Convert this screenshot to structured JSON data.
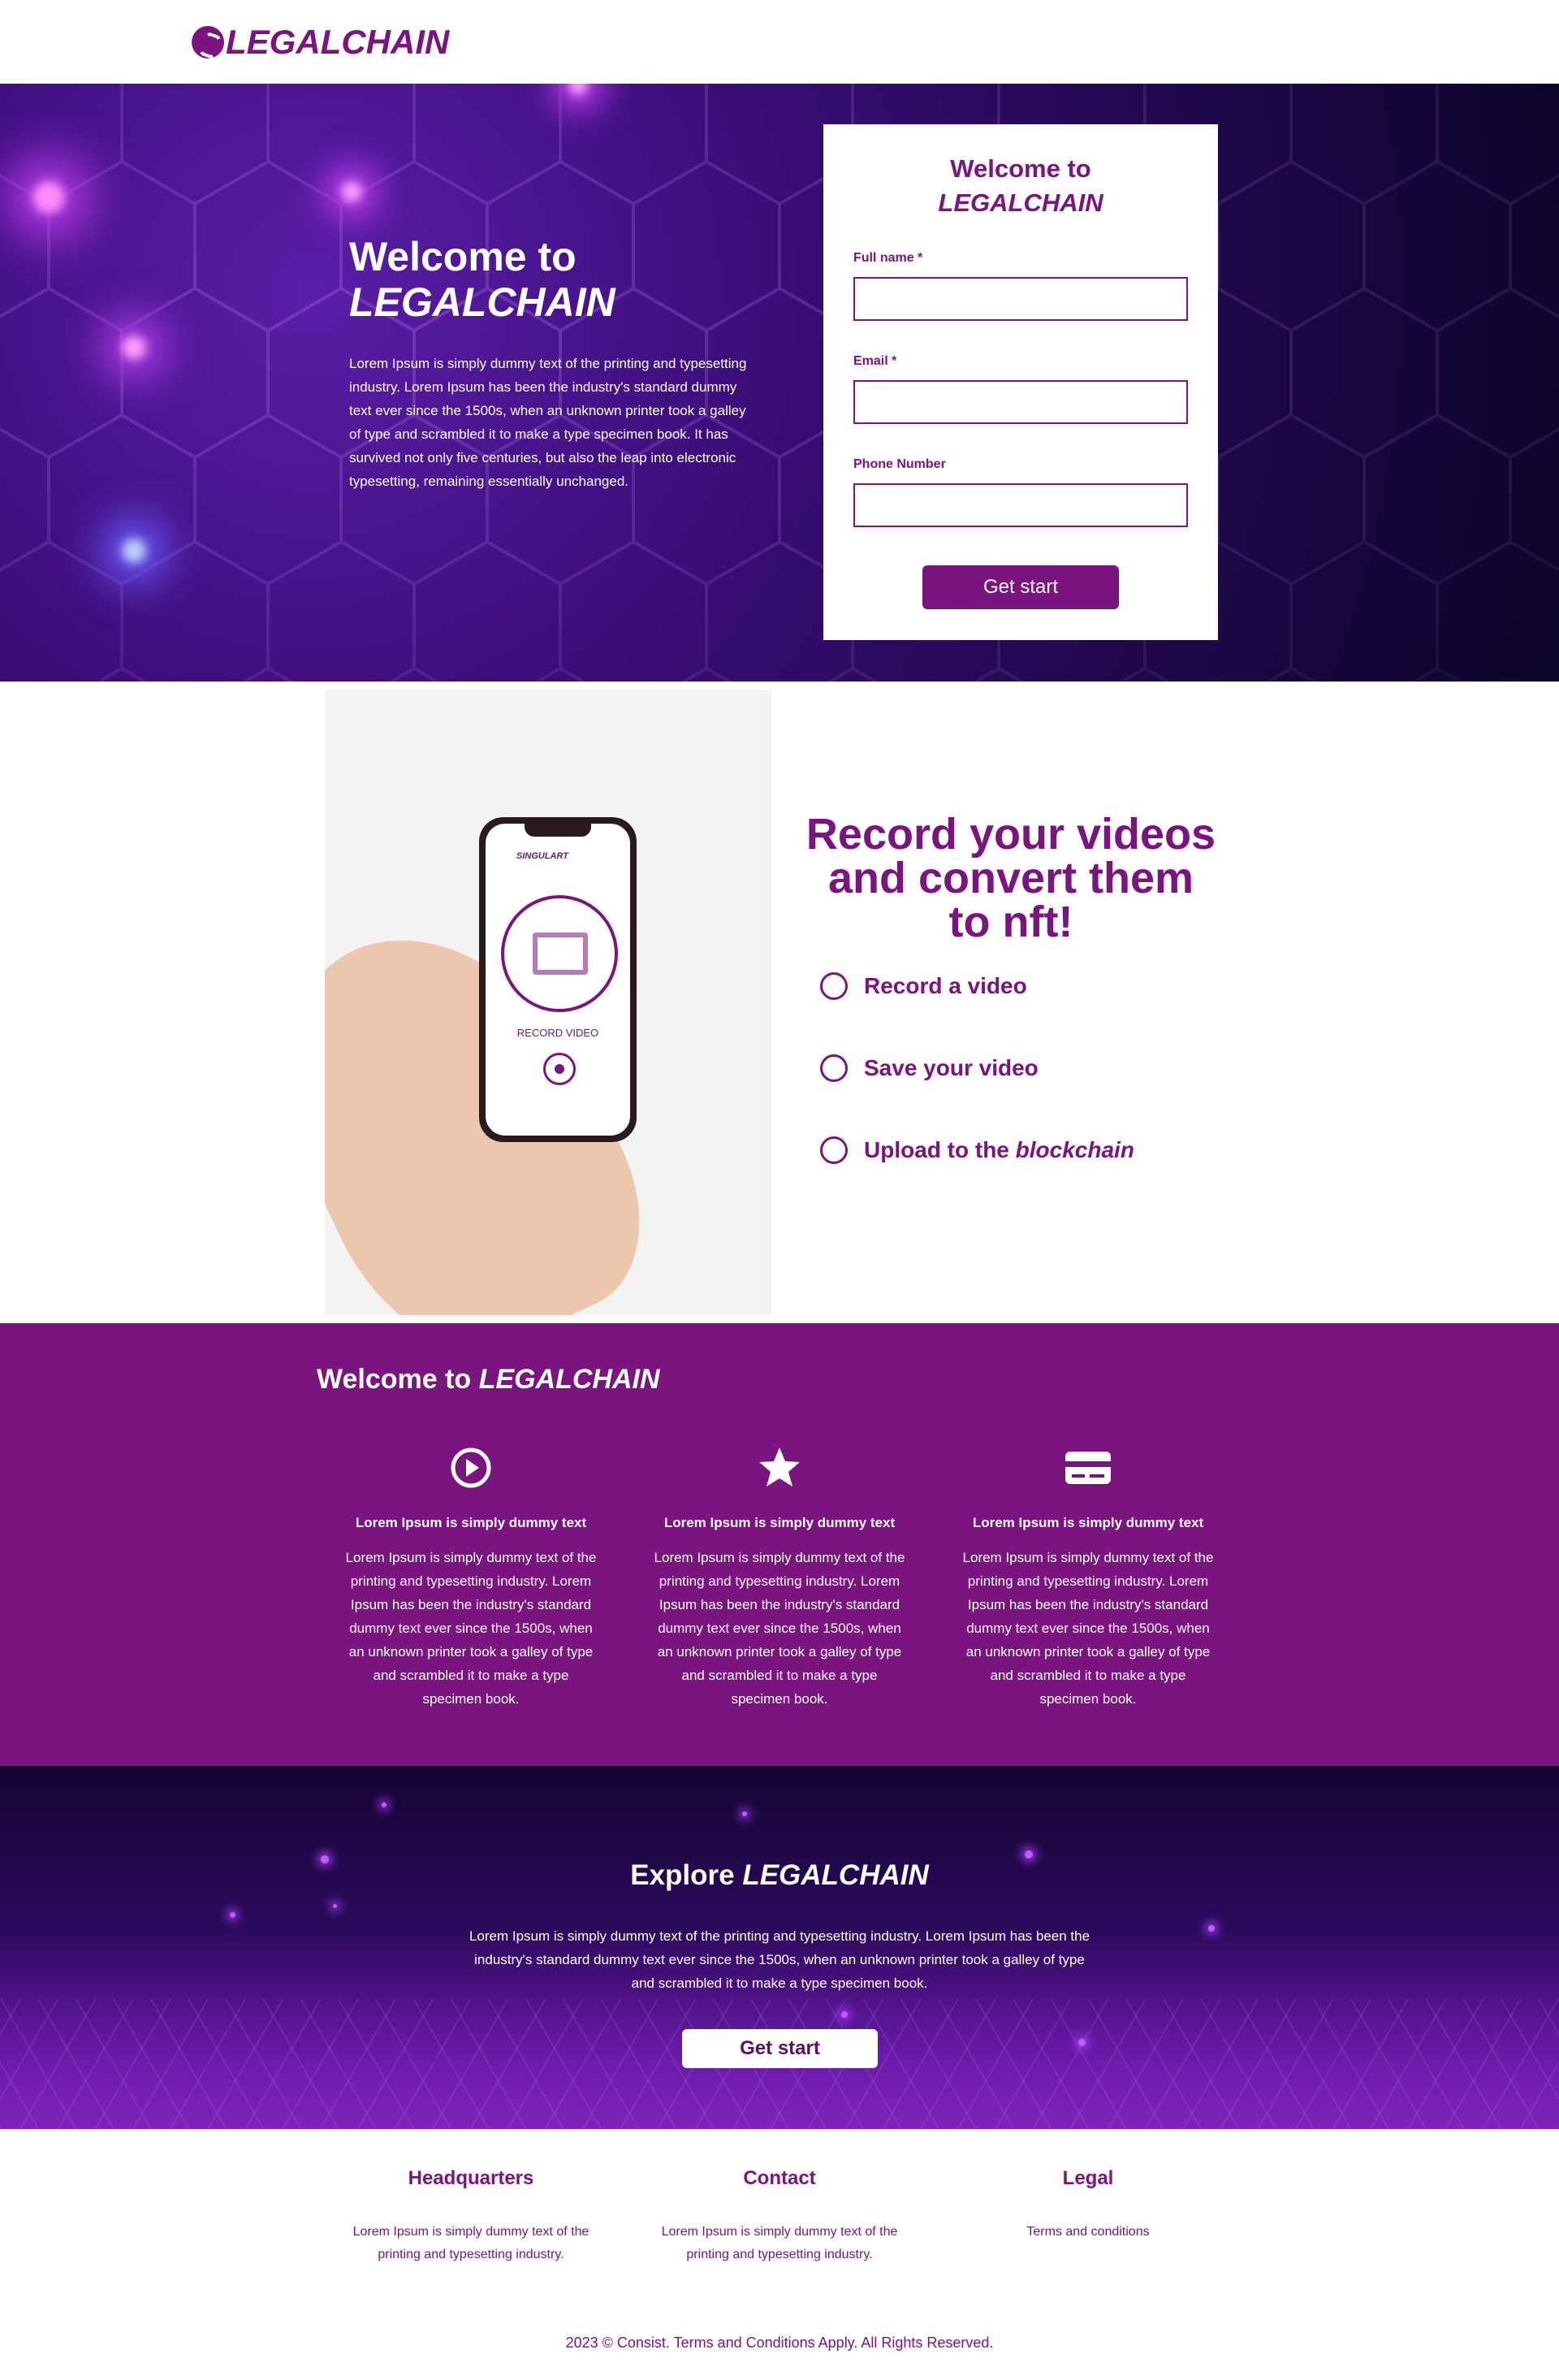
{
  "header": {
    "logo_text": "LEGALCHAIN"
  },
  "hero": {
    "title_line1": "Welcome to",
    "title_line2": "LEGALCHAIN",
    "body": "Lorem Ipsum is simply dummy text of the printing and typesetting industry. Lorem Ipsum has been the industry's standard dummy text ever since the 1500s, when an unknown printer took a galley of type and scrambled it to make a type specimen book. It has survived not only five centuries, but also the leap into electronic typesetting, remaining essentially unchanged."
  },
  "form": {
    "title_line1": "Welcome to",
    "title_line2": "LEGALCHAIN",
    "full_name_label": "Full name *",
    "full_name_value": "",
    "email_label": "Email *",
    "email_value": "",
    "phone_label": "Phone Number",
    "phone_value": "",
    "submit_label": "Get start"
  },
  "record": {
    "phone_brand": "SINGULART",
    "phone_record_label": "RECORD VIDEO",
    "title": "Record your videos and convert them to nft!",
    "steps": [
      {
        "label": "Record a video"
      },
      {
        "label": "Save your video"
      },
      {
        "label": "Upload to the ",
        "label_em": "blockchain"
      }
    ]
  },
  "features": {
    "title_prefix": "Welcome to ",
    "title_em": "LEGALCHAIN",
    "items": [
      {
        "icon": "play-circle-icon",
        "heading": "Lorem Ipsum is simply dummy text",
        "text": "Lorem Ipsum is simply dummy text of the printing and typesetting industry. Lorem Ipsum has been the industry's standard dummy text ever since the 1500s, when an unknown printer took a galley of type and scrambled it to make a type specimen book."
      },
      {
        "icon": "star-icon",
        "heading": "Lorem Ipsum is simply dummy text",
        "text": "Lorem Ipsum is simply dummy text of the printing and typesetting industry. Lorem Ipsum has been the industry's standard dummy text ever since the 1500s, when an unknown printer took a galley of type and scrambled it to make a type specimen book."
      },
      {
        "icon": "credit-card-icon",
        "heading": "Lorem Ipsum is simply dummy text",
        "text": "Lorem Ipsum is simply dummy text of the printing and typesetting industry. Lorem Ipsum has been the industry's standard dummy text ever since the 1500s, when an unknown printer took a galley of type and scrambled it to make a type specimen book."
      }
    ]
  },
  "explore": {
    "title_prefix": "Explore ",
    "title_em": "LEGALCHAIN",
    "body": "Lorem Ipsum is simply dummy text of the printing and typesetting industry. Lorem Ipsum has been the industry's standard dummy text ever since the 1500s, when an unknown printer took a galley of type and scrambled it to make a type specimen book.",
    "button_label": "Get start"
  },
  "footer": {
    "columns": [
      {
        "heading": "Headquarters",
        "text": "Lorem Ipsum is simply dummy text of the printing and typesetting industry."
      },
      {
        "heading": "Contact",
        "text": "Lorem Ipsum is simply dummy text of the printing and typesetting industry."
      },
      {
        "heading": "Legal",
        "text": "Terms and conditions"
      }
    ],
    "copyright": "2023 © Consist. Terms and Conditions Apply. All Rights Reserved."
  },
  "colors": {
    "brand": "#7a1580",
    "hero_dark": "#1d0849",
    "white": "#ffffff"
  }
}
